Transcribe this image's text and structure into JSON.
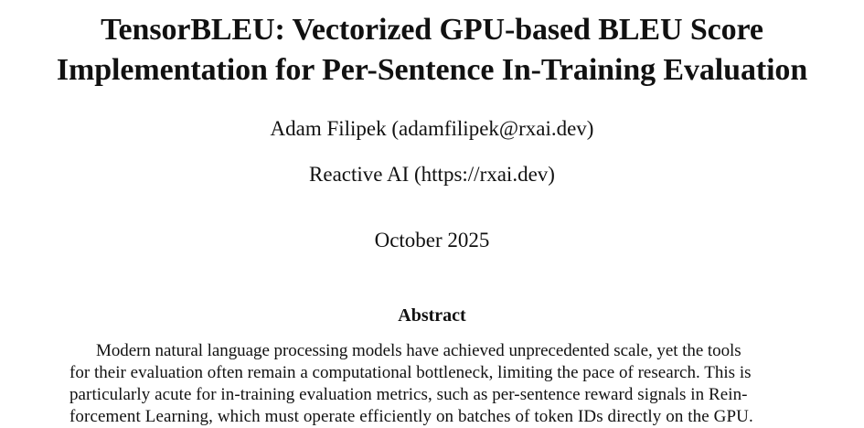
{
  "paper": {
    "title_lines": [
      "TensorBLEU: Vectorized GPU-based BLEU Score",
      "Implementation for Per-Sentence In-Training Evaluation"
    ],
    "author": "Adam Filipek (adamfilipek@rxai.dev)",
    "affiliation": "Reactive AI (https://rxai.dev)",
    "date": "October 2025",
    "abstract_heading": "Abstract",
    "abstract_lines": [
      "Modern natural language processing models have achieved unprecedented scale, yet the tools",
      "for their evaluation often remain a computational bottleneck, limiting the pace of research. This is",
      "particularly acute for in-training evaluation metrics, such as per-sentence reward signals in Rein-",
      "forcement Learning, which must operate efficiently on batches of token IDs directly on the GPU."
    ]
  }
}
